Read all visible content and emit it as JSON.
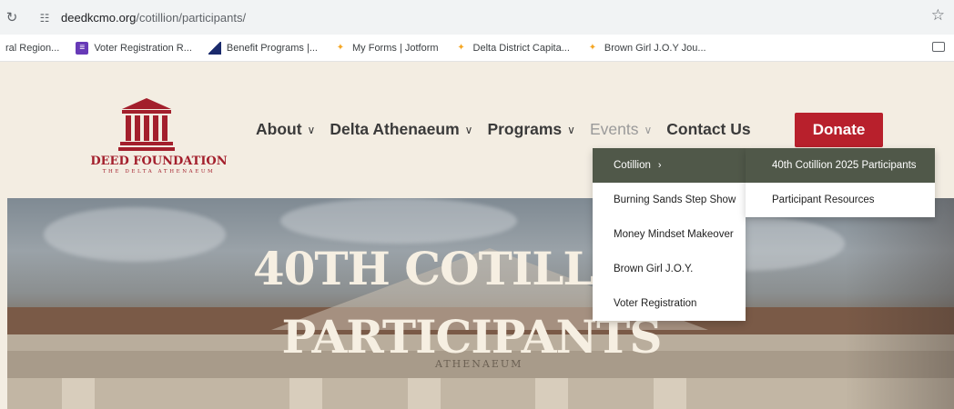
{
  "browser": {
    "url_host": "deedkcmo.org",
    "url_path": "/cotillion/participants/",
    "bookmarks": [
      {
        "label": "ral Region...",
        "icon": "none"
      },
      {
        "label": "Voter Registration R...",
        "icon": "form-grid-icon"
      },
      {
        "label": "Benefit Programs |...",
        "icon": "benefit-icon"
      },
      {
        "label": "My Forms | Jotform",
        "icon": "jotform-icon"
      },
      {
        "label": "Delta District Capita...",
        "icon": "jotform-icon"
      },
      {
        "label": "Brown Girl J.O.Y Jou...",
        "icon": "jotform-icon"
      }
    ]
  },
  "logo": {
    "title": "DEED FOUNDATION",
    "subtitle": "THE DELTA ATHENAEUM"
  },
  "nav": {
    "items": [
      {
        "label": "About"
      },
      {
        "label": "Delta Athenaeum"
      },
      {
        "label": "Programs"
      },
      {
        "label": "Events"
      },
      {
        "label": "Contact Us"
      }
    ],
    "donate": "Donate"
  },
  "hero": {
    "line1": "40TH COTILLION",
    "line2": "PARTICIPANTS",
    "building_inscription": "ATHENAEUM"
  },
  "events_menu": {
    "items": [
      {
        "label": "Cotillion",
        "has_submenu": true
      },
      {
        "label": "Burning Sands Step Show"
      },
      {
        "label": "Money Mindset Makeover"
      },
      {
        "label": "Brown Girl J.O.Y."
      },
      {
        "label": "Voter Registration"
      }
    ]
  },
  "cotillion_submenu": {
    "items": [
      {
        "label": "40th Cotillion 2025 Participants"
      },
      {
        "label": "Participant Resources"
      }
    ]
  },
  "colors": {
    "brand_red": "#b8202c",
    "menu_active": "#505849",
    "header_bg": "#f3ede2"
  }
}
